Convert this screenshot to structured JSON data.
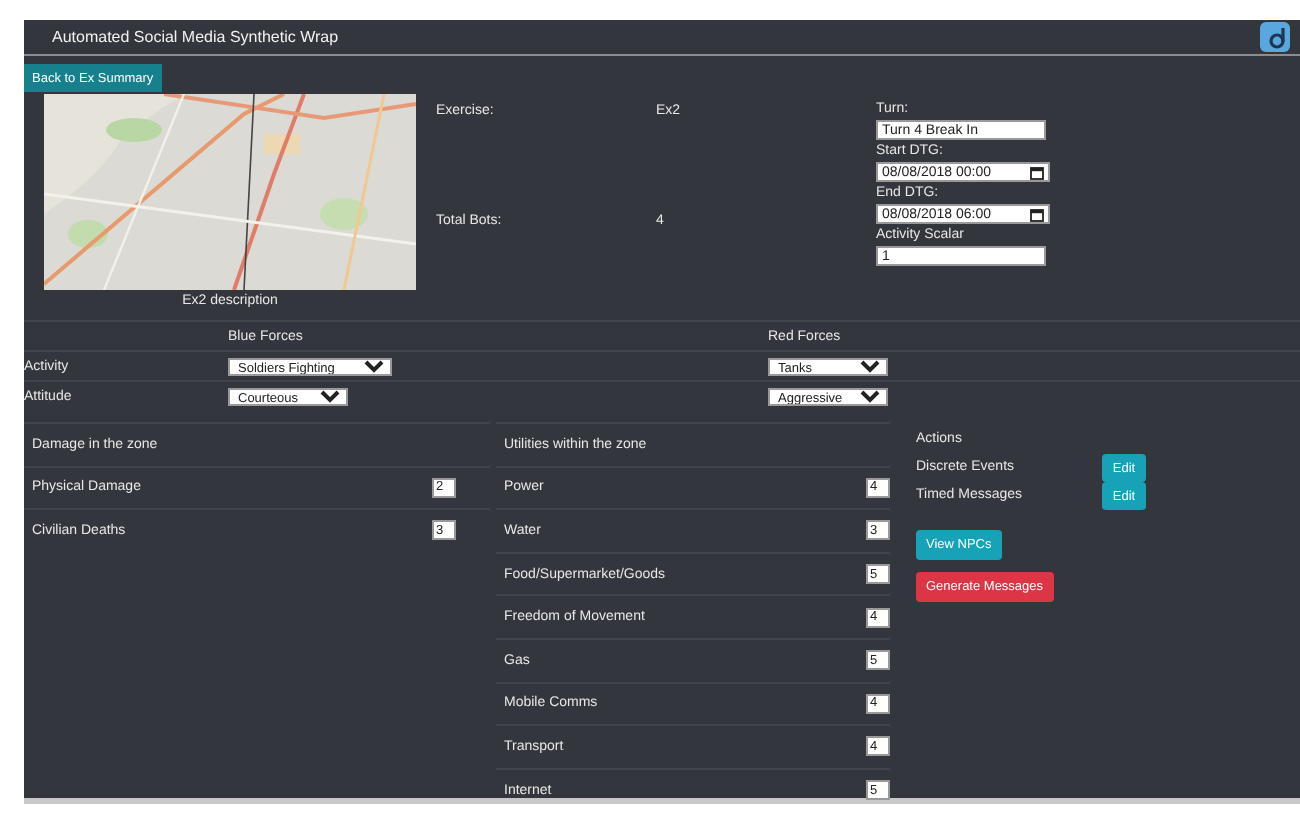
{
  "app": {
    "title": "Automated Social Media Synthetic Wrap"
  },
  "back_button": "Back to Ex Summary",
  "map": {
    "kind": "picture",
    "caption": "Ex2 description"
  },
  "summary": [
    {
      "label": "Exercise:",
      "value": "Ex2"
    },
    {
      "label": "Total Bots:",
      "value": "4"
    }
  ],
  "settings": [
    {
      "label": "Turn:",
      "kind": "text",
      "value": "Turn 4 Break In"
    },
    {
      "label": "Start DTG:",
      "kind": "datetime",
      "value": "08/08/2018 00:00"
    },
    {
      "label": "End DTG:",
      "kind": "datetime",
      "value": "08/08/2018 06:00"
    },
    {
      "label": "Activity Scalar",
      "kind": "text",
      "value": "1"
    }
  ],
  "forces": {
    "columns": [
      "Blue Forces",
      "Red Forces"
    ],
    "rows": [
      {
        "label": "Activity",
        "values": [
          "Soldiers Fighting",
          "Tanks"
        ]
      },
      {
        "label": "Attitude",
        "values": [
          "Courteous",
          "Aggressive"
        ]
      }
    ]
  },
  "damage": {
    "title": "Damage in the zone",
    "items": [
      {
        "label": "Physical Damage",
        "value": "2"
      },
      {
        "label": "Civilian Deaths",
        "value": "3"
      }
    ]
  },
  "utilities": {
    "title": "Utilities within the zone",
    "items": [
      {
        "label": "Power",
        "value": "4"
      },
      {
        "label": "Water",
        "value": "3"
      },
      {
        "label": "Food/Supermarket/Goods",
        "value": "5"
      },
      {
        "label": "Freedom of Movement",
        "value": "4"
      },
      {
        "label": "Gas",
        "value": "5"
      },
      {
        "label": "Mobile Comms",
        "value": "4"
      },
      {
        "label": "Transport",
        "value": "4"
      },
      {
        "label": "Internet",
        "value": "5"
      }
    ]
  },
  "actions": {
    "title": "Actions",
    "items": [
      {
        "label": "Discrete Events",
        "button": "Edit"
      },
      {
        "label": "Timed Messages",
        "button": "Edit"
      }
    ],
    "buttons": [
      {
        "label": "View NPCs",
        "kind": "info"
      },
      {
        "label": "Generate Messages",
        "kind": "danger"
      }
    ]
  }
}
